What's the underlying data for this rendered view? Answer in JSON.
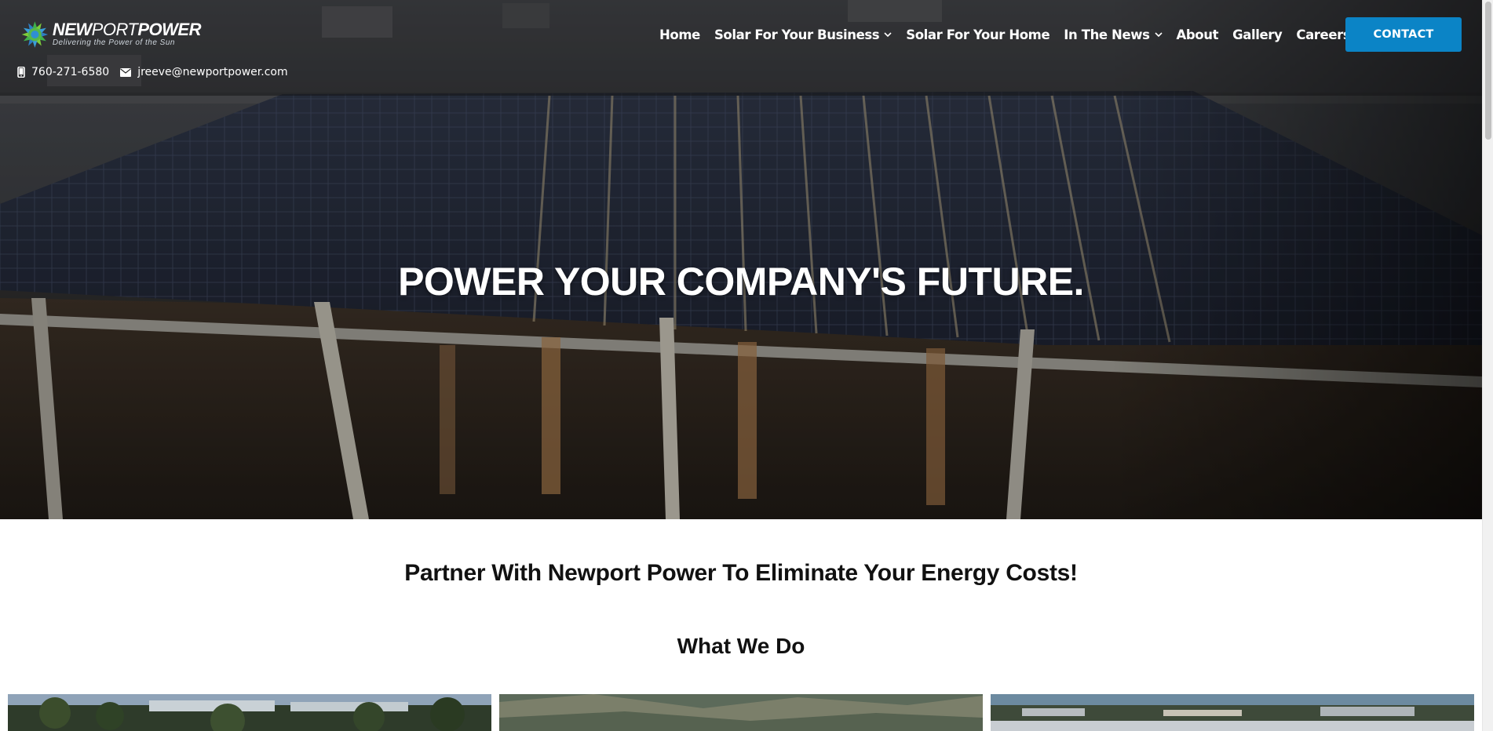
{
  "brand": {
    "name_bold_1": "NEW",
    "name_thin": "PORT",
    "name_bold_2": "POWER",
    "tagline": "Delivering the Power of the Sun",
    "accent_color": "#0b84c6"
  },
  "contact_strip": {
    "phone": "760-271-6580",
    "email": "jreeve@newportpower.com",
    "phone_icon": "mobile-phone-icon",
    "email_icon": "envelope-icon"
  },
  "nav": {
    "items": [
      {
        "label": "Home",
        "has_dropdown": false
      },
      {
        "label": "Solar For Your Business",
        "has_dropdown": true
      },
      {
        "label": "Solar For Your Home",
        "has_dropdown": false
      },
      {
        "label": "In The News",
        "has_dropdown": true
      },
      {
        "label": "About",
        "has_dropdown": false
      },
      {
        "label": "Gallery",
        "has_dropdown": false
      },
      {
        "label": "Careers",
        "has_dropdown": false
      }
    ],
    "cta_label": "CONTACT"
  },
  "hero": {
    "title": "POWER YOUR COMPANY'S FUTURE."
  },
  "intro": {
    "tagline": "Partner With Newport Power To Eliminate Your Energy Costs!",
    "section_title": "What We Do"
  },
  "cards": [
    {
      "icon": "office-campus-photo"
    },
    {
      "icon": "hillside-landscape-photo"
    },
    {
      "icon": "city-rooftop-photo"
    }
  ]
}
